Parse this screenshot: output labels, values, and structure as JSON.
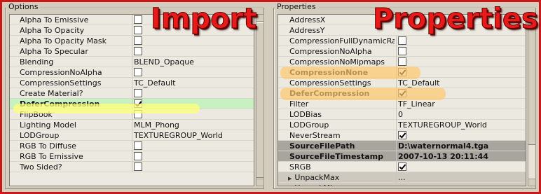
{
  "left": {
    "title": "Options",
    "banner": "Import",
    "rows": [
      {
        "name": "Alpha To Emissive",
        "type": "check",
        "checked": false
      },
      {
        "name": "Alpha To Opacity",
        "type": "check",
        "checked": false
      },
      {
        "name": "Alpha To Opacity Mask",
        "type": "check",
        "checked": false
      },
      {
        "name": "Alpha To Specular",
        "type": "check",
        "checked": false
      },
      {
        "name": "Blending",
        "type": "text",
        "value": "BLEND_Opaque"
      },
      {
        "name": "CompressionNoAlpha",
        "type": "check",
        "checked": false
      },
      {
        "name": "CompressionSettings",
        "type": "text",
        "value": "TC_Default"
      },
      {
        "name": "Create Material?",
        "type": "check",
        "checked": false
      },
      {
        "name": "DeferCompression",
        "type": "check",
        "checked": true,
        "style": "highlight bold"
      },
      {
        "name": "FlipBook",
        "type": "check",
        "checked": false
      },
      {
        "name": "Lighting Model",
        "type": "text",
        "value": "MLM_Phong"
      },
      {
        "name": "LODGroup",
        "type": "text",
        "value": "TEXTUREGROUP_World"
      },
      {
        "name": "RGB To Diffuse",
        "type": "check",
        "checked": false
      },
      {
        "name": "RGB To Emissive",
        "type": "check",
        "checked": false
      },
      {
        "name": "Two Sided?",
        "type": "check",
        "checked": false
      }
    ]
  },
  "right": {
    "title": "Properties",
    "banner": "Properties",
    "rows": [
      {
        "name": "AddressX",
        "type": "text",
        "value": ""
      },
      {
        "name": "AddressY",
        "type": "text",
        "value": ""
      },
      {
        "name": "CompressionFullDynamicRange",
        "type": "check",
        "checked": false
      },
      {
        "name": "CompressionNoAlpha",
        "type": "check",
        "checked": false
      },
      {
        "name": "CompressionNoMipmaps",
        "type": "check",
        "checked": false
      },
      {
        "name": "CompressionNone",
        "type": "check",
        "checked": true,
        "style": "bold"
      },
      {
        "name": "CompressionSettings",
        "type": "text",
        "value": "TC_Default"
      },
      {
        "name": "DeferCompression",
        "type": "check",
        "checked": true,
        "style": "bold"
      },
      {
        "name": "Filter",
        "type": "text",
        "value": "TF_Linear"
      },
      {
        "name": "LODBias",
        "type": "text",
        "value": "0"
      },
      {
        "name": "LODGroup",
        "type": "text",
        "value": "TEXTUREGROUP_World"
      },
      {
        "name": "NeverStream",
        "type": "check",
        "checked": true
      },
      {
        "name": "SourceFilePath",
        "type": "text",
        "value": "D:\\waternormal4.tga",
        "style": "dark"
      },
      {
        "name": "SourceFileTimestamp",
        "type": "text",
        "value": "2007-10-13 20:11:44",
        "style": "dark"
      },
      {
        "name": "SRGB",
        "type": "check",
        "checked": true
      },
      {
        "name": "UnpackMax",
        "type": "group",
        "value": "..."
      },
      {
        "name": "UnpackMin",
        "type": "group",
        "value": ""
      }
    ]
  },
  "colors": {
    "frame": "#c81818",
    "banner": "#e81a1a",
    "row_highlight": "#c7f1c0",
    "marker_yellow": "#ffff78",
    "marker_orange": "#ffc86e"
  }
}
